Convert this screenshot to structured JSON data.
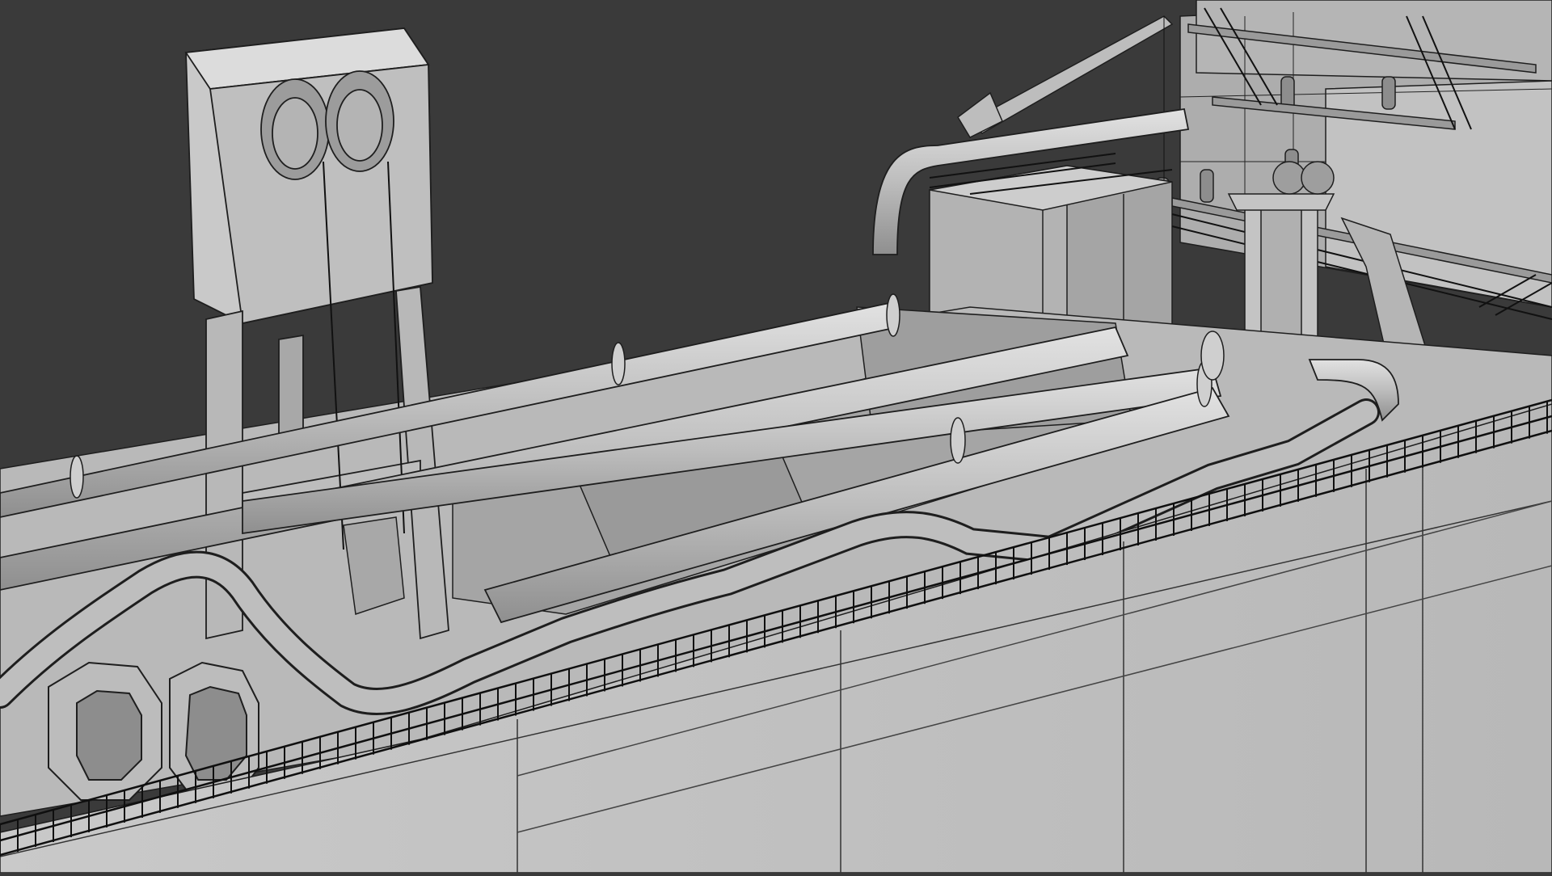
{
  "scene": {
    "subject": "dredger-ship-deck-wireframe",
    "colors": {
      "background": "#3a3a3a",
      "surface_light": "#c8c8c8",
      "surface_mid": "#a9a9a9",
      "surface_dark": "#8a8a8a",
      "edge": "#1e1e1e",
      "railing": "#111111"
    }
  }
}
